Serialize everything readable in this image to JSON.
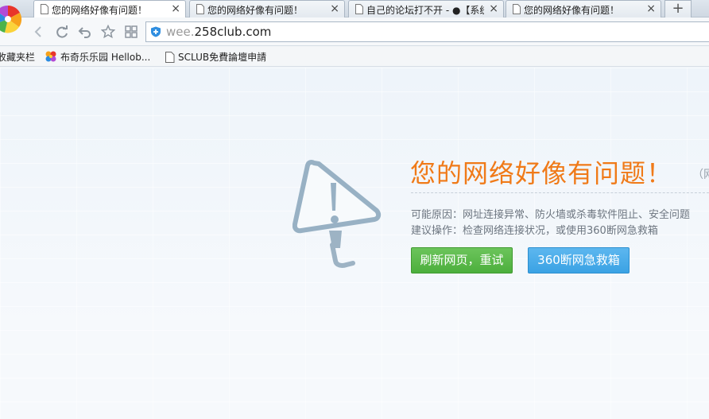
{
  "tabs": [
    {
      "label": "您的网络好像有问题！",
      "active": true
    },
    {
      "label": "您的网络好像有问题！",
      "active": false
    },
    {
      "label": "自己的论坛打不开 - ●【系统",
      "active": false
    },
    {
      "label": "您的网络好像有问题！",
      "active": false
    }
  ],
  "tab_close_glyph": "×",
  "new_tab_glyph": "+",
  "address": {
    "prefix": "wee.",
    "domain": "258club.com"
  },
  "bookmarks": [
    {
      "label": "收藏夹栏",
      "icon": "star-folder-icon"
    },
    {
      "label": "布奇乐乐园 Hellob...",
      "icon": "colorful-flower-icon"
    },
    {
      "label": "SCLUB免費論壇申請",
      "icon": "page-icon"
    }
  ],
  "error": {
    "title": "您的网络好像有问题！",
    "note": "（网",
    "reason": "可能原因：网址连接异常、防火墙或杀毒软件阻止、安全问题",
    "suggestion": "建议操作：检查网络连接状况，或使用360断网急救箱",
    "refresh_button": "刷新网页，重试",
    "rescue_button": "360断网急救箱"
  },
  "colors": {
    "title_orange": "#f07a18",
    "refresh_green": "#4caf3d",
    "rescue_blue": "#3aa2e4"
  }
}
